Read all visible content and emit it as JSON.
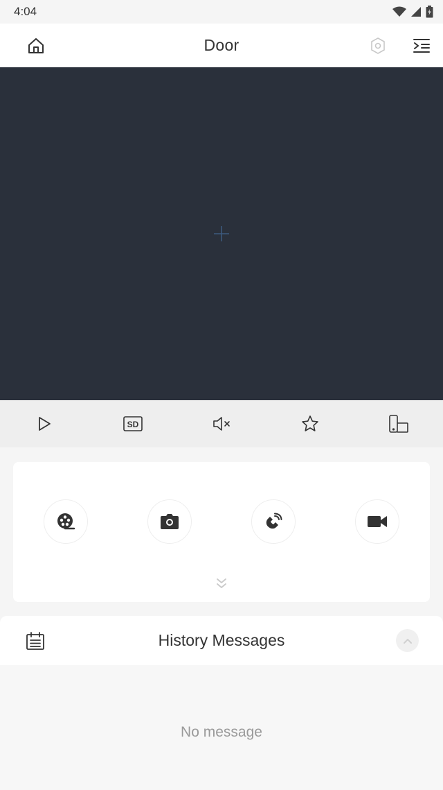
{
  "status_bar": {
    "time": "4:04",
    "icons": [
      "wifi-icon",
      "signal-icon",
      "battery-icon"
    ]
  },
  "header": {
    "title": "Door",
    "left_icon": "home-icon",
    "right_icons": [
      "settings-icon",
      "menu-icon"
    ]
  },
  "video": {
    "placeholder_icon": "plus-icon",
    "background": "#2a303b"
  },
  "controls": [
    {
      "name": "play",
      "icon": "play-icon"
    },
    {
      "name": "sd-quality",
      "icon": "sd-icon",
      "label": "SD"
    },
    {
      "name": "mute",
      "icon": "mute-icon"
    },
    {
      "name": "favorite",
      "icon": "star-icon"
    },
    {
      "name": "fullscreen",
      "icon": "phone-rotate-icon"
    }
  ],
  "actions": [
    {
      "name": "album",
      "icon": "film-reel-icon"
    },
    {
      "name": "snapshot",
      "icon": "camera-icon"
    },
    {
      "name": "talk",
      "icon": "phone-call-icon"
    },
    {
      "name": "record",
      "icon": "video-camera-icon"
    }
  ],
  "history": {
    "title": "History Messages",
    "empty_text": "No message",
    "icon": "calendar-icon"
  }
}
